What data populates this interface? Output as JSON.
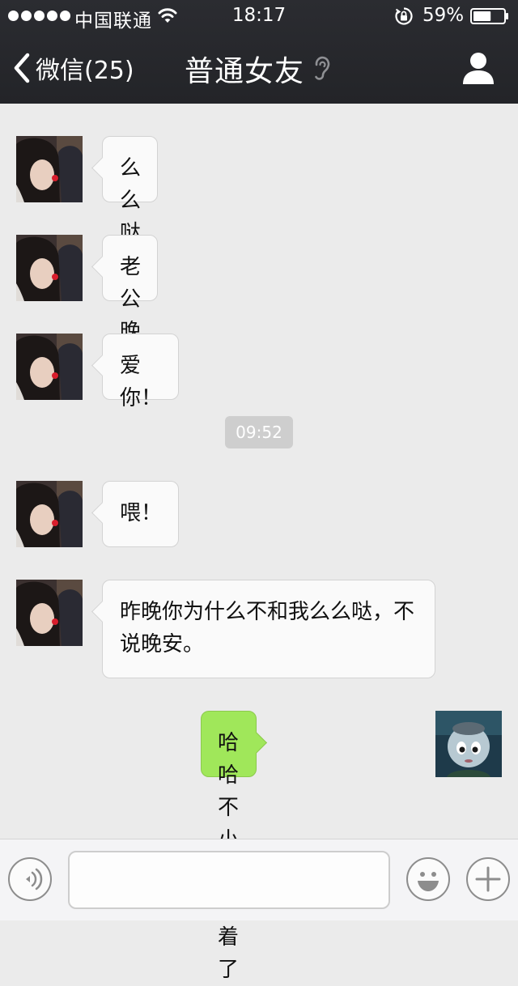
{
  "status_bar": {
    "carrier": "中国联通",
    "time": "18:17",
    "battery_percent": "59%",
    "battery_level": 0.59,
    "signal_bars": 5,
    "icons": [
      "signal-dots-icon",
      "wifi-icon",
      "orientation-lock-icon",
      "battery-icon"
    ]
  },
  "nav": {
    "back_label": "微信(25)",
    "title": "普通女友",
    "icons": [
      "back-chevron-icon",
      "earpiece-mode-icon",
      "profile-icon"
    ]
  },
  "messages": [
    {
      "side": "left",
      "text": "么么哒~"
    },
    {
      "side": "left",
      "text": "老公晚安~"
    },
    {
      "side": "left",
      "text": "爱你！"
    },
    {
      "side": "left",
      "text": "喂！"
    },
    {
      "side": "left",
      "text": "昨晚你为什么不和我么么哒，不说晚安。"
    },
    {
      "side": "right",
      "text": "哈哈不小心睡着了"
    }
  ],
  "timestamp": "09:52",
  "input_bar": {
    "value": "",
    "placeholder": "",
    "icons": [
      "voice-input-icon",
      "emoji-icon",
      "plus-icon"
    ]
  },
  "colors": {
    "header_bg": "#27282c",
    "chat_bg": "#ebebeb",
    "incoming_bubble": "#fafafa",
    "outgoing_bubble": "#a0e75a",
    "timestamp_bg": "#cecece"
  }
}
